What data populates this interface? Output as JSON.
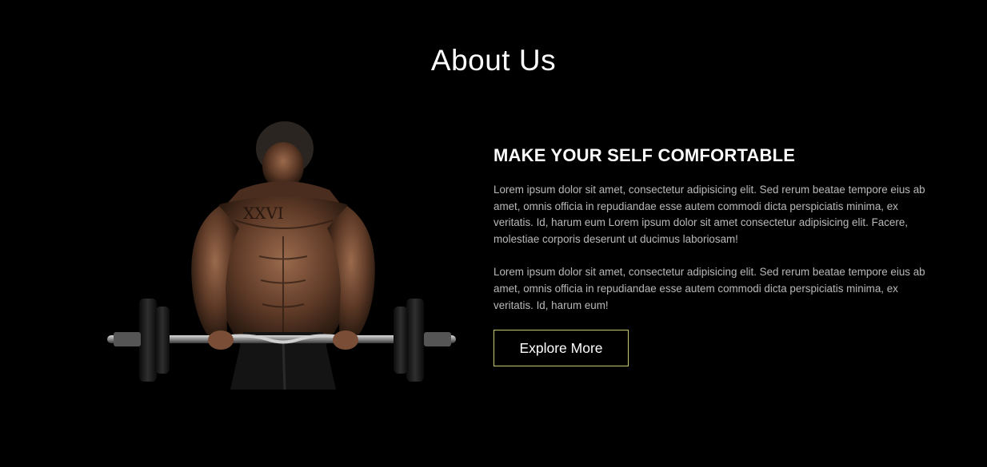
{
  "section": {
    "title": "About Us"
  },
  "about": {
    "headline": "MAKE YOUR SELF COMFORTABLE",
    "paragraph_1": "Lorem ipsum dolor sit amet, consectetur adipisicing elit. Sed rerum beatae tempore eius ab amet, omnis officia in repudiandae esse autem commodi dicta perspiciatis minima, ex veritatis. Id, harum eum Lorem ipsum dolor sit amet consectetur adipisicing elit. Facere, molestiae corporis deserunt ut ducimus laboriosam!",
    "paragraph_2": "Lorem ipsum dolor sit amet, consectetur adipisicing elit. Sed rerum beatae tempore eius ab amet, omnis officia in repudiandae esse autem commodi dicta perspiciatis minima, ex veritatis. Id, harum eum!",
    "cta_label": "Explore More"
  },
  "image": {
    "icon": "bodybuilder-barbell-photo"
  },
  "colors": {
    "background": "#000000",
    "text": "#ffffff",
    "muted_text": "#b9b9b9",
    "button_border": "#c7c96a"
  }
}
